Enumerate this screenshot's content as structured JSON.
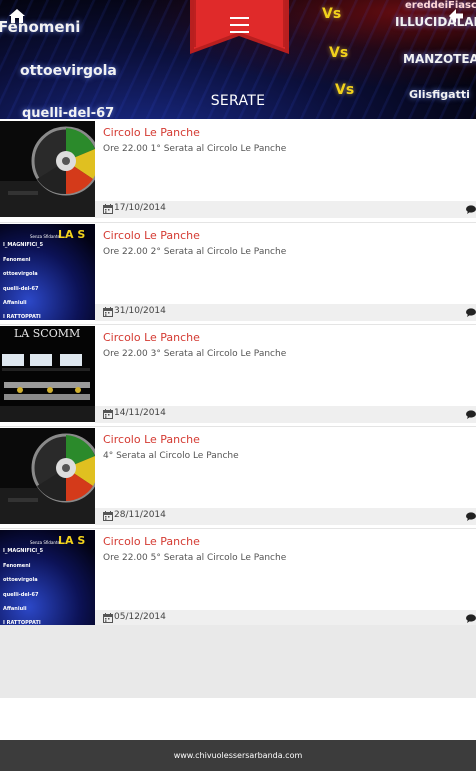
{
  "header": {
    "title": "SERATE",
    "home_icon": "home-icon",
    "back_icon": "arrow-left-icon",
    "menu_icon": "hamburger-menu-icon",
    "ribbon_color": "#d42a2a",
    "background_words": {
      "w1": "Fenomeni",
      "w2": "ottoevirgola",
      "w3": "quelli-del-67",
      "w4": "ILLUCIDALABBRA",
      "w5": "MANZOTEAM",
      "w6": "Glisfigatti",
      "w7": "ereddeiFiasco",
      "vs": "Vs"
    }
  },
  "events": [
    {
      "title": "Circolo Le Panche",
      "desc": "Ore 22.00 1° Serata al Circolo Le Panche",
      "date": "17/10/2014",
      "thumb": "wheel-image"
    },
    {
      "title": "Circolo Le Panche",
      "desc": "Ore 22.00 2° Serata al Circolo Le Panche",
      "date": "31/10/2014",
      "thumb": "team-list-image"
    },
    {
      "title": "Circolo Le Panche",
      "desc": "Ore 22.00 3° Serata al Circolo Le Panche",
      "date": "14/11/2014",
      "thumb": "stage-image"
    },
    {
      "title": "Circolo Le Panche",
      "desc": "4° Serata al Circolo Le Panche",
      "date": "28/11/2014",
      "thumb": "wheel-image"
    },
    {
      "title": "Circolo Le Panche",
      "desc": "Ore 22.00 5° Serata al Circolo Le Panche",
      "date": "05/12/2014",
      "thumb": "team-list-image"
    }
  ],
  "thumbs": {
    "team_title": "LA S",
    "team_subtitle": "Senza Sfidante",
    "teams": [
      "I_MAGNIFICI_5",
      "Fenomeni",
      "ottoevirgola",
      "quelli-del-67",
      "Affaniuli",
      "I RATTOPPATI"
    ],
    "stage_title": "LA SCOMM"
  },
  "footer": {
    "text": "www.chivuolessersarbanda.com"
  },
  "colors": {
    "accent": "#d43a32",
    "footer_bg": "#3c3c3c",
    "date_bar": "#efefef"
  }
}
